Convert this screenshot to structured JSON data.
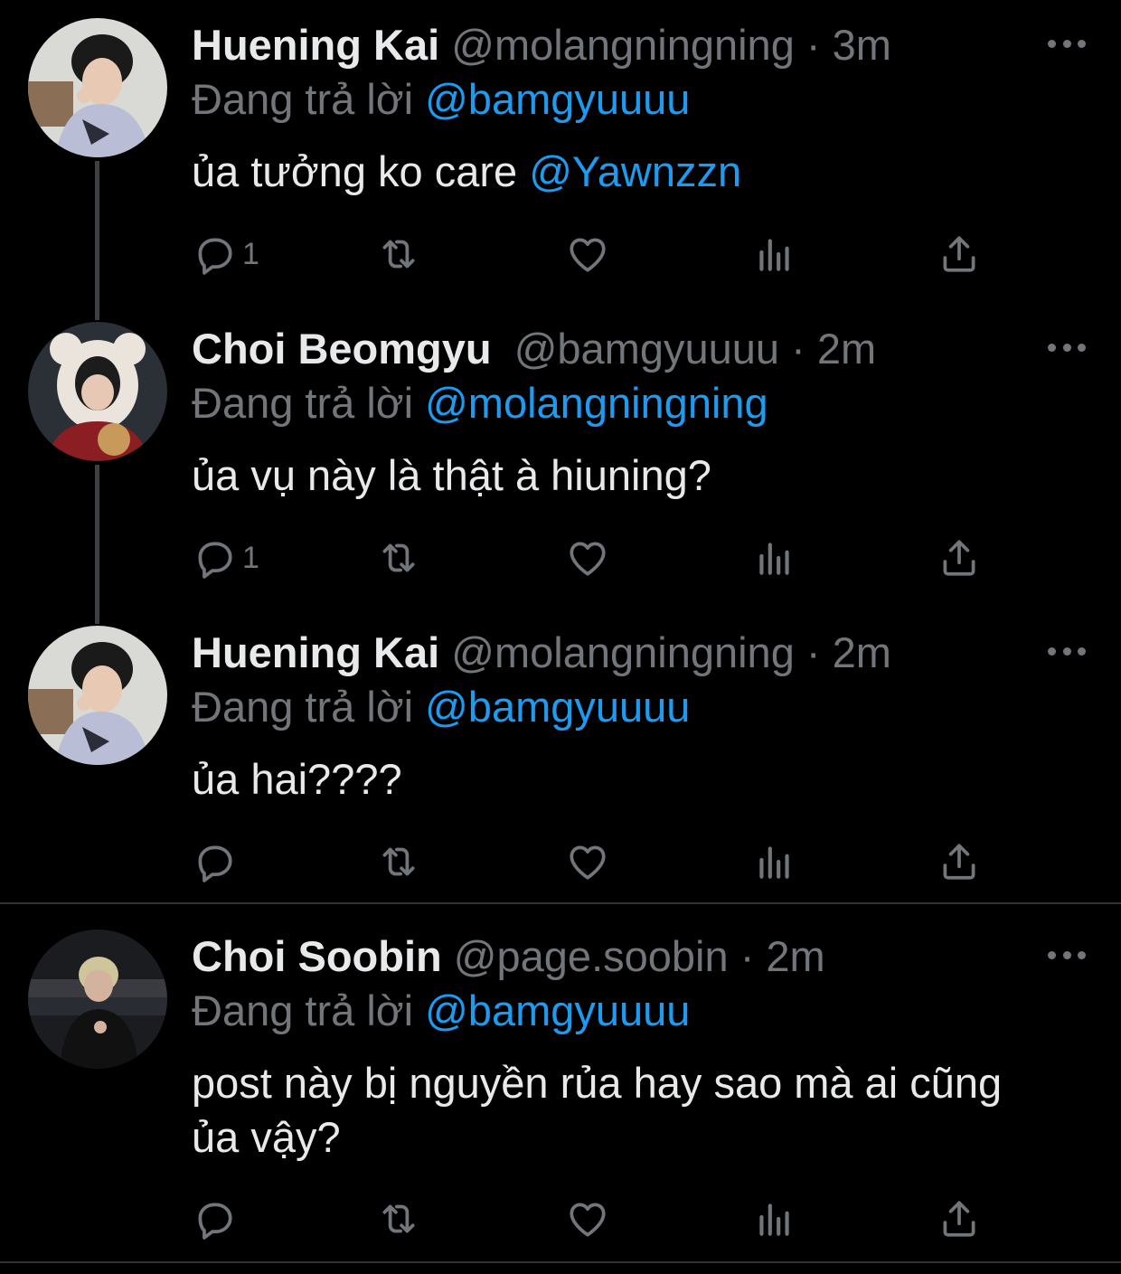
{
  "tweets": [
    {
      "name": "Huening Kai",
      "handle": "@molangningning",
      "time": "3m",
      "replying_prefix": "Đang trả lời",
      "replying_to": "@bamgyuuuu",
      "text": "ủa tưởng ko care ",
      "text_mention": "@Yawnzzn",
      "reply_count": "1"
    },
    {
      "name": "Choi Beomgyu",
      "handle": "@bamgyuuuu",
      "time": "2m",
      "replying_prefix": "Đang trả lời",
      "replying_to": "@molangningning",
      "text": "ủa vụ này là thật à hiuning?",
      "reply_count": "1"
    },
    {
      "name": "Huening Kai",
      "handle": "@molangningning",
      "time": "2m",
      "replying_prefix": "Đang trả lời",
      "replying_to": "@bamgyuuuu",
      "text": "ủa hai????",
      "reply_count": ""
    },
    {
      "name": "Choi Soobin",
      "handle": "@page.soobin",
      "time": "2m",
      "replying_prefix": "Đang trả lời",
      "replying_to": "@bamgyuuuu",
      "text": "post này bị nguyền rủa hay sao mà ai cũng ủa vậy?",
      "reply_count": ""
    }
  ],
  "separator": "·",
  "icons": [
    "reply-icon",
    "retweet-icon",
    "like-icon",
    "analytics-icon",
    "share-icon",
    "more-icon"
  ],
  "colors": {
    "background": "#000000",
    "text": "#e7e9ea",
    "muted": "#71767b",
    "mention": "#1d9bf0"
  }
}
